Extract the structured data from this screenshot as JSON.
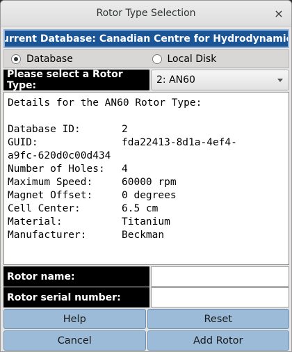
{
  "window": {
    "title": "Rotor Type Selection",
    "close_glyph": "×"
  },
  "banner": {
    "text": "Current Database: Canadian Centre for Hydrodynamics"
  },
  "source": {
    "options": [
      {
        "label": "Database",
        "selected": true
      },
      {
        "label": "Local Disk",
        "selected": false
      }
    ]
  },
  "rotor_select": {
    "label": "Please select a Rotor Type:",
    "selected_value": "2: AN60"
  },
  "details": {
    "heading": "Details for the AN60 Rotor Type:",
    "lines": [
      {
        "key": "Database ID:",
        "value": "2"
      },
      {
        "key": "GUID:",
        "value": "fda22413-8d1a-4ef4-"
      },
      {
        "key": "",
        "value": "a9fc-620d0c00d434",
        "full": true
      },
      {
        "key": "Number of Holes:",
        "value": "4"
      },
      {
        "key": "Maximum Speed:",
        "value": "60000 rpm"
      },
      {
        "key": "Magnet Offset:",
        "value": "0 degrees"
      },
      {
        "key": "Cell Center:",
        "value": "6.5 cm"
      },
      {
        "key": "Material:",
        "value": "Titanium"
      },
      {
        "key": "Manufacturer:",
        "value": "Beckman"
      }
    ]
  },
  "fields": {
    "rotor_name": {
      "label": "Rotor name:",
      "value": ""
    },
    "rotor_serial": {
      "label": "Rotor serial number:",
      "value": ""
    }
  },
  "buttons": {
    "help": "Help",
    "reset": "Reset",
    "cancel": "Cancel",
    "add_rotor": "Add Rotor"
  },
  "colors": {
    "banner_bg": "#1b5596",
    "button_bg": "#9bbbd8",
    "label_bg": "#000000"
  }
}
